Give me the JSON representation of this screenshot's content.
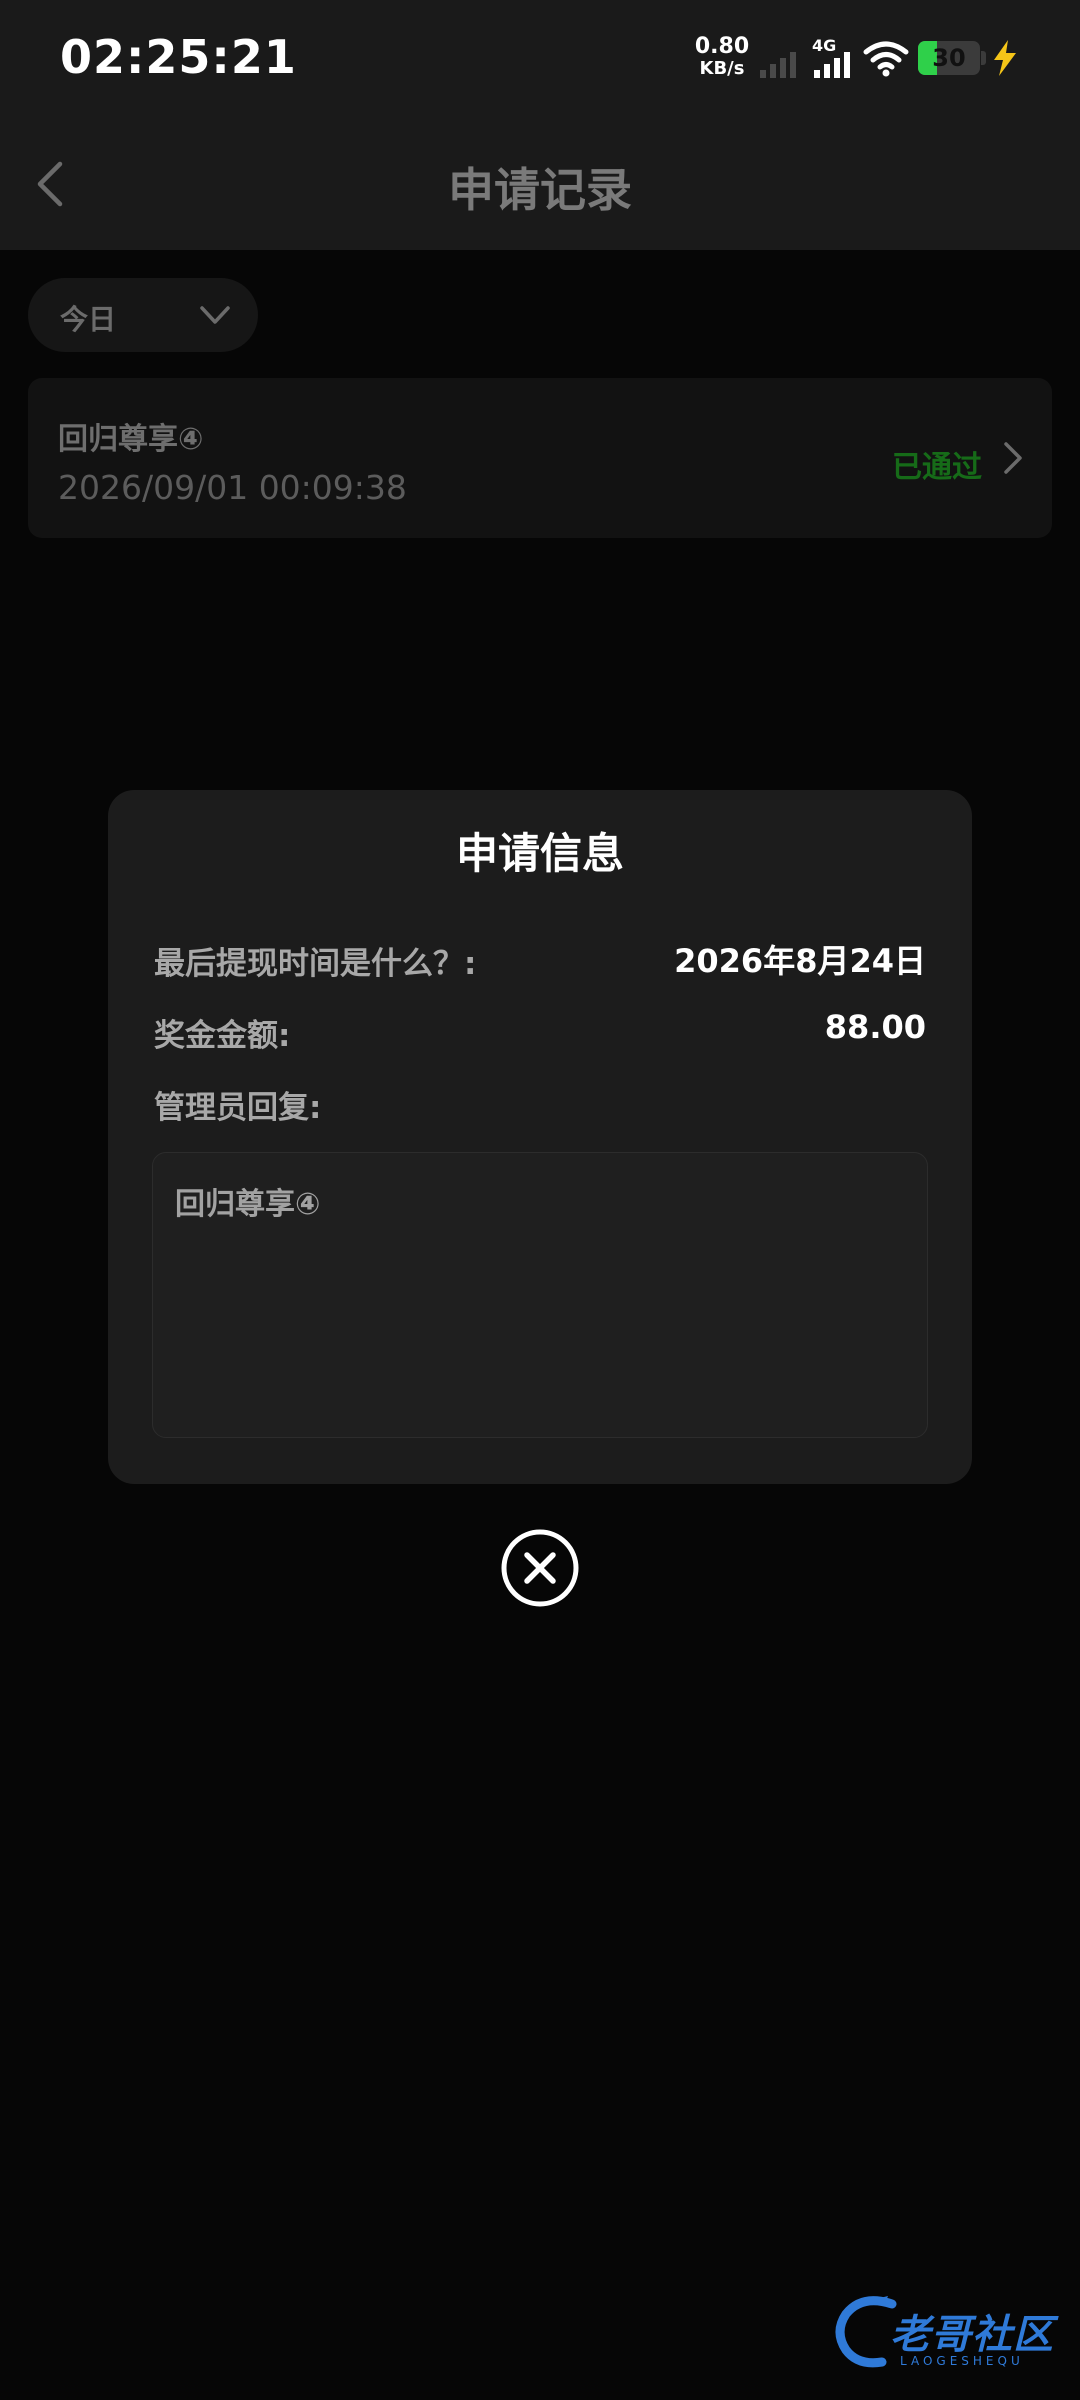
{
  "status_bar": {
    "time": "02:25:21",
    "net_speed_value": "0.80",
    "net_speed_unit": "KB/s",
    "network_type": "4G",
    "battery_level": "30",
    "battery_percent": 30,
    "battery_color": "#2fd04a",
    "charging_color": "#f5c518"
  },
  "header": {
    "title": "申请记录",
    "back_icon": "chevron-left-icon"
  },
  "filter": {
    "selected": "今日",
    "icon": "chevron-down-icon"
  },
  "records": [
    {
      "title": "回归尊享④",
      "time": "2026/09/01 00:09:38",
      "status": "已通过",
      "status_color": "#166b18"
    }
  ],
  "modal": {
    "title": "申请信息",
    "rows": [
      {
        "label": "最后提现时间是什么？:",
        "value": "2026年8月24日"
      },
      {
        "label": "奖金金额:",
        "value": "88.00"
      }
    ],
    "reply_label": "管理员回复:",
    "reply_text": "回归尊享④",
    "close_icon": "close-circle-icon"
  },
  "watermark": {
    "text": "老哥社区",
    "subtext": "LAOGESHEQU",
    "color": "#2f7ad8"
  }
}
